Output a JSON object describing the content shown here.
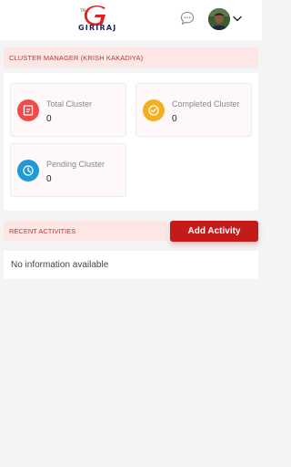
{
  "header": {
    "logo_text": "GIRIRAJ",
    "logo_tm": "TM",
    "chat_icon": "chat-bubble-icon",
    "avatar": "user-avatar",
    "menu_icon": "chevron-down-icon"
  },
  "cluster_manager": {
    "title": "CLUSTER MANAGER (KRISH KAKADIYA)"
  },
  "stats": [
    {
      "label": "Total Cluster",
      "value": "0",
      "icon": "document-icon",
      "color": "#ef4b4b"
    },
    {
      "label": "Completed Cluster",
      "value": "0",
      "icon": "check-circle-icon",
      "color": "#f2b01e"
    },
    {
      "label": "Pending Cluster",
      "value": "0",
      "icon": "clock-icon",
      "color": "#1f9ad6"
    }
  ],
  "activities": {
    "title": "RECENT ACTIVITIES",
    "add_button": "Add Activity",
    "empty_text": "No information available"
  },
  "colors": {
    "brand_red": "#c41a1a",
    "section_bg": "#fde6e6",
    "logo_navy": "#1a2a6c"
  }
}
